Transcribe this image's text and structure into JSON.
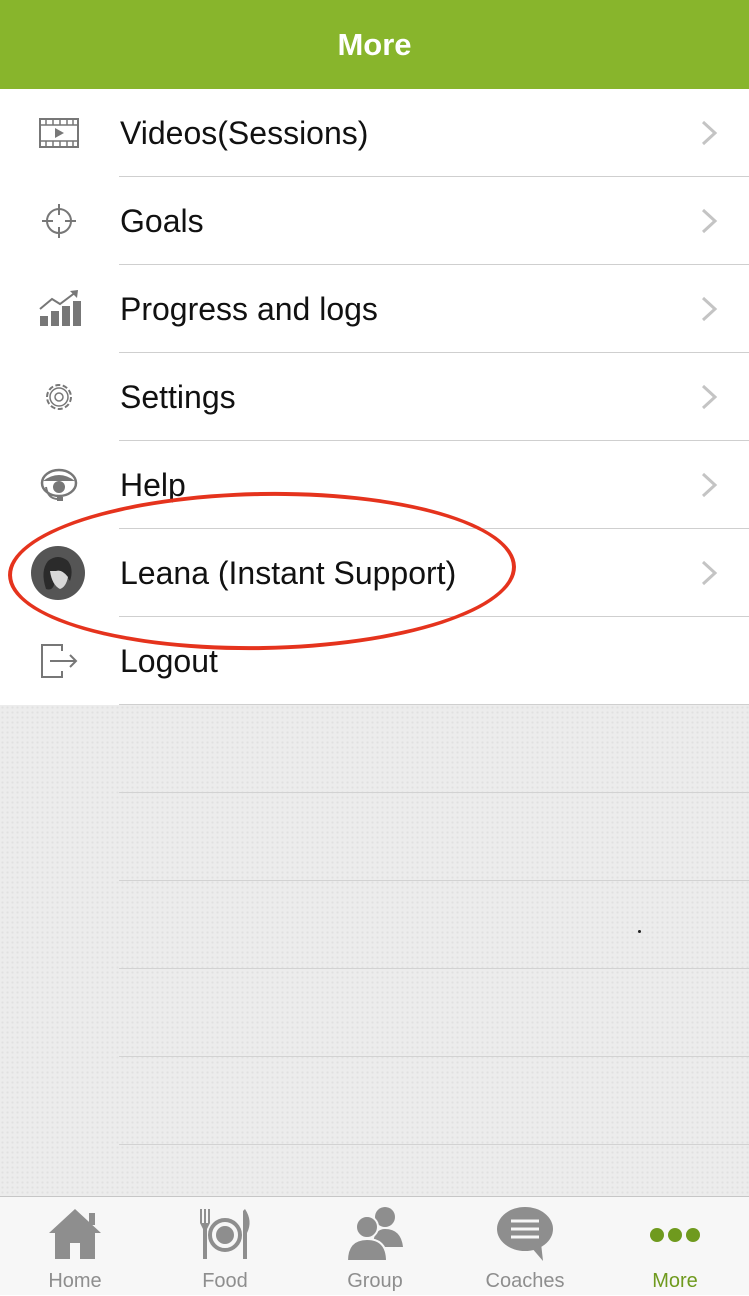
{
  "header": {
    "title": "More"
  },
  "menu": {
    "items": [
      {
        "label": "Videos(Sessions)",
        "icon": "video-icon",
        "chevron": true
      },
      {
        "label": "Goals",
        "icon": "crosshair-icon",
        "chevron": true
      },
      {
        "label": "Progress and logs",
        "icon": "bar-chart-icon",
        "chevron": true
      },
      {
        "label": "Settings",
        "icon": "gear-icon",
        "chevron": true
      },
      {
        "label": "Help",
        "icon": "headset-icon",
        "chevron": true
      },
      {
        "label": "Leana (Instant Support)",
        "icon": "avatar-icon",
        "chevron": true
      },
      {
        "label": "Logout",
        "icon": "logout-icon",
        "chevron": false
      }
    ]
  },
  "tabbar": {
    "tabs": [
      {
        "label": "Home",
        "icon": "home-icon",
        "active": false
      },
      {
        "label": "Food",
        "icon": "plate-cutlery-icon",
        "active": false
      },
      {
        "label": "Group",
        "icon": "group-icon",
        "active": false
      },
      {
        "label": "Coaches",
        "icon": "chat-bubble-icon",
        "active": false
      },
      {
        "label": "More",
        "icon": "more-dots-icon",
        "active": true
      }
    ]
  },
  "colors": {
    "brand_green": "#88b52c",
    "active_tab": "#6f9a1e",
    "inactive_tab": "#8e8e8e",
    "annotation_red": "#e5331d"
  }
}
